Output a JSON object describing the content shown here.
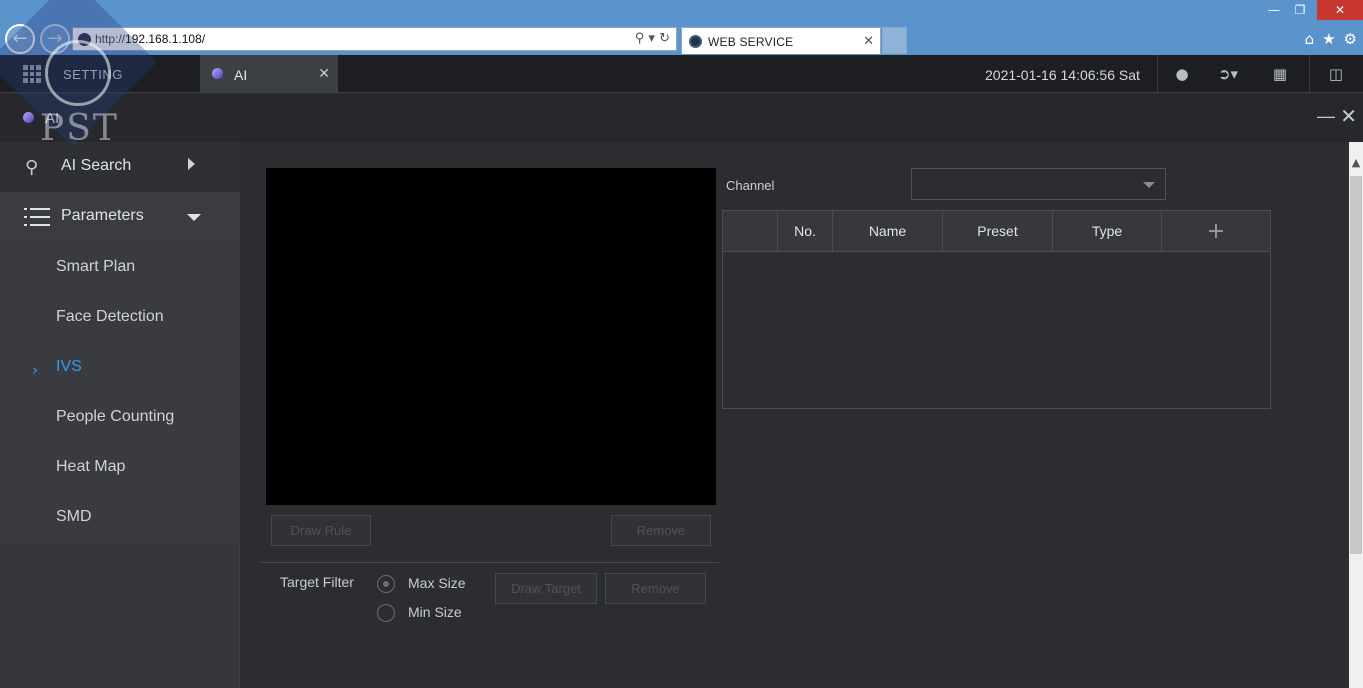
{
  "browser": {
    "url_prefix": "http://",
    "url_host": "192.168.1.108/",
    "tab_label": "WEB SERVICE"
  },
  "header": {
    "setting_label": "SETTING",
    "app_tab_label": "AI",
    "datetime": "2021-01-16 14:06:56 Sat"
  },
  "watermark": {
    "text": "PST"
  },
  "panel": {
    "title": "AI"
  },
  "sidebar": {
    "ai_search": "AI Search",
    "parameters": "Parameters",
    "items": [
      {
        "label": "Smart Plan"
      },
      {
        "label": "Face Detection"
      },
      {
        "label": "IVS",
        "active": true
      },
      {
        "label": "People Counting"
      },
      {
        "label": "Heat Map"
      },
      {
        "label": "SMD"
      }
    ]
  },
  "main": {
    "draw_rule_label": "Draw Rule",
    "remove_label": "Remove",
    "target_filter_label": "Target Filter",
    "max_size_label": "Max Size",
    "min_size_label": "Min Size",
    "draw_target_label": "Draw Target",
    "remove2_label": "Remove",
    "channel_label": "Channel",
    "channel_value": "",
    "table": {
      "columns": [
        "",
        "No.",
        "Name",
        "Preset",
        "Type",
        "+"
      ]
    }
  },
  "colors": {
    "accent": "#2f9df0",
    "browser_bar": "#5b94cc",
    "background": "#2b2d31"
  }
}
